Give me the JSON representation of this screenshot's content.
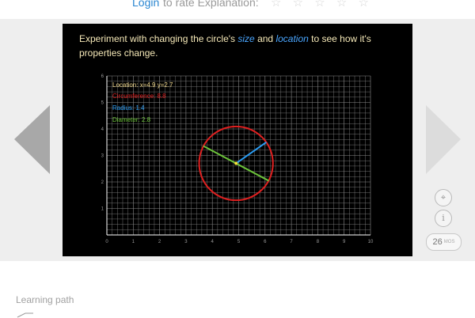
{
  "header": {
    "login_label": "Login",
    "rate_text": "to rate Explanation:",
    "stars": "☆ ☆ ☆ ☆ ☆"
  },
  "panel": {
    "caption_before": "Experiment with changing the circle's ",
    "caption_size": "size",
    "caption_and": " and ",
    "caption_location": "location",
    "caption_after": " to see how it's properties change.",
    "readouts": {
      "location": "Location:  x=4.9  y=2.7",
      "circumference": "Circumference: 8.8",
      "radius": "Radius: 1.4",
      "diameter": "Diameter: 2.8"
    },
    "x_ticks": [
      "0",
      "1",
      "2",
      "3",
      "4",
      "5",
      "6",
      "7",
      "8",
      "9",
      "10"
    ],
    "y_ticks": [
      "1",
      "2",
      "3",
      "4",
      "5",
      "6"
    ]
  },
  "circle": {
    "cx": 4.9,
    "cy": 2.7,
    "r": 1.4,
    "radius_angle_deg": 35,
    "diameter_angle_deg": 152
  },
  "colors": {
    "grid": "#8a8a8a",
    "circle": "#e02020",
    "radius": "#2a9df4",
    "diameter": "#6cc33a",
    "location_text": "#f2d98c",
    "caption": "#f6e9b8"
  },
  "nav": {
    "prev_icon": "left-triangle-icon",
    "next_icon": "right-triangle-icon"
  },
  "side_buttons": {
    "focus_icon": "crosshair-icon",
    "info_icon": "info-icon",
    "info_glyph": "i",
    "focus_glyph": "⌖"
  },
  "count": {
    "value": "26",
    "unit": "MOS"
  },
  "footer": {
    "learning_path": "Learning path"
  }
}
